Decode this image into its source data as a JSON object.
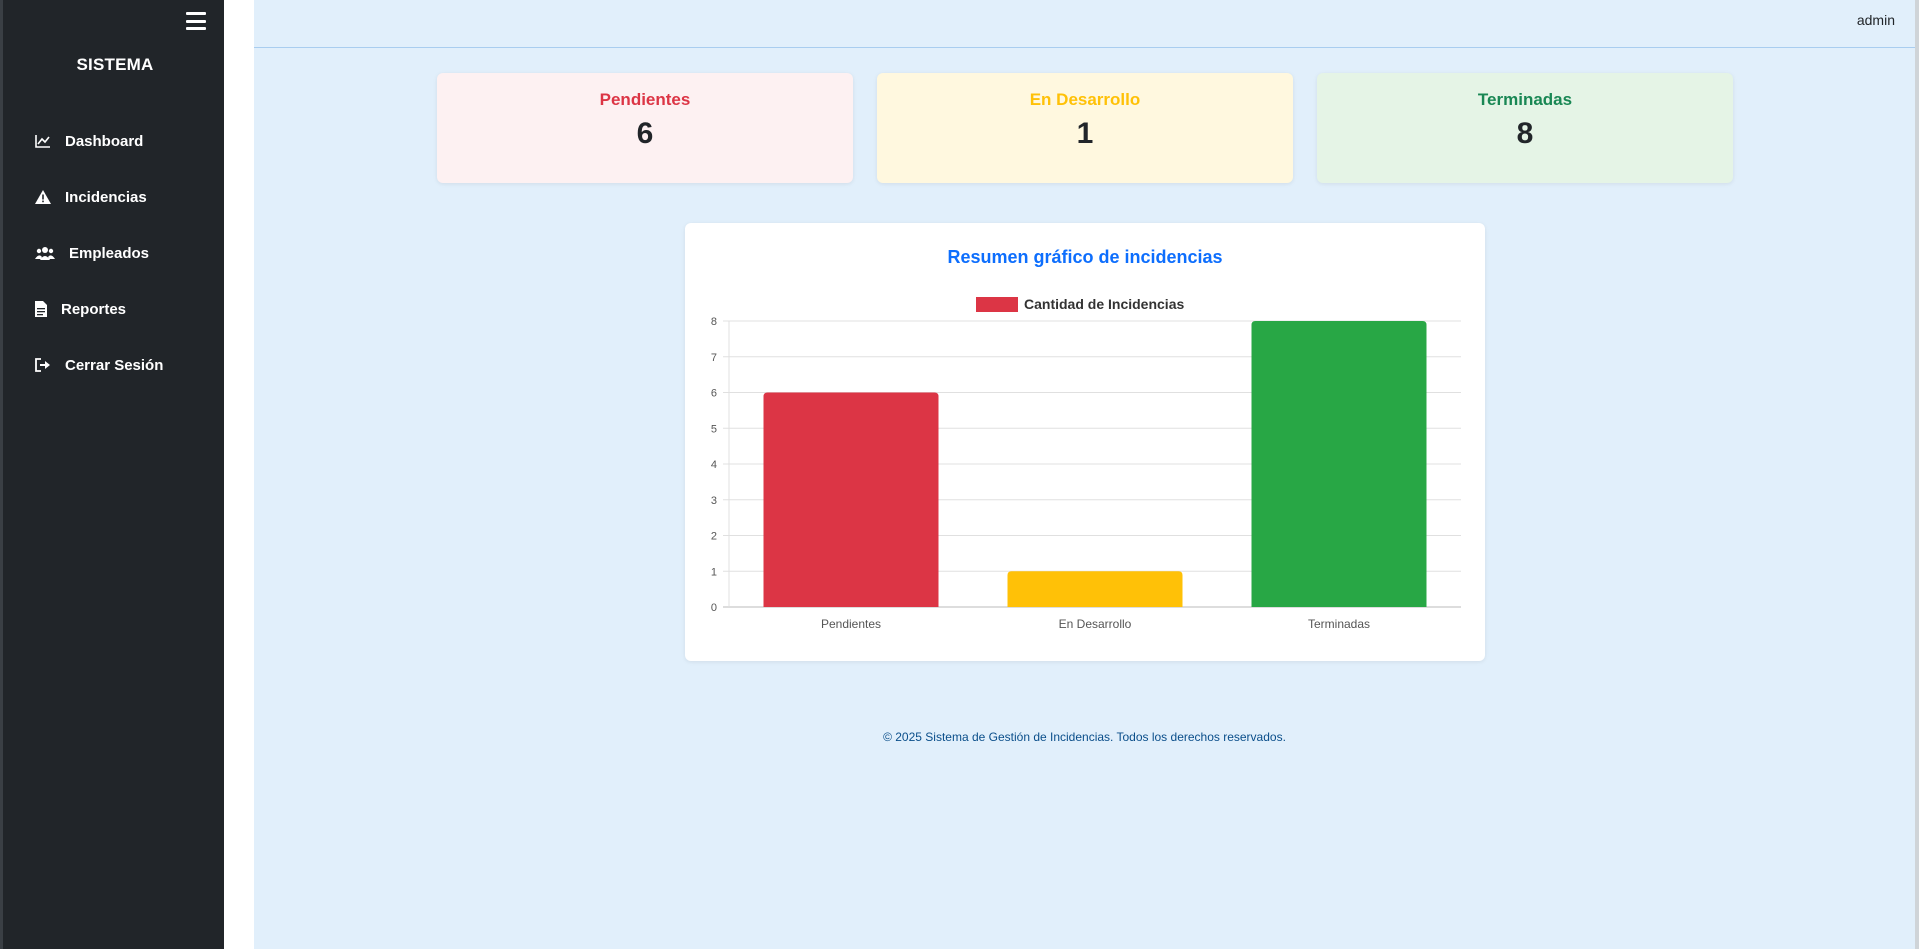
{
  "sidebar": {
    "brand": "SISTEMA",
    "items": [
      {
        "label": "Dashboard",
        "icon": "chart-line-icon"
      },
      {
        "label": "Incidencias",
        "icon": "warning-icon"
      },
      {
        "label": "Empleados",
        "icon": "users-icon"
      },
      {
        "label": "Reportes",
        "icon": "file-icon"
      },
      {
        "label": "Cerrar Sesión",
        "icon": "logout-icon"
      }
    ]
  },
  "header": {
    "user": "admin"
  },
  "cards": [
    {
      "title": "Pendientes",
      "value": "6",
      "color": "#dc3545",
      "bg": "#fdf1f2"
    },
    {
      "title": "En Desarrollo",
      "value": "1",
      "color": "#ffc107",
      "bg": "#fff8df"
    },
    {
      "title": "Terminadas",
      "value": "8",
      "color": "#198754",
      "bg": "#e5f4e6"
    }
  ],
  "chart_title": "Resumen gráfico de incidencias",
  "chart_data": {
    "type": "bar",
    "categories": [
      "Pendientes",
      "En Desarrollo",
      "Terminadas"
    ],
    "series": [
      {
        "name": "Cantidad de Incidencias",
        "values": [
          6,
          1,
          8
        ]
      }
    ],
    "colors": [
      "#dc3545",
      "#ffc107",
      "#28a745"
    ],
    "ylim": [
      0,
      8
    ],
    "yticks": [
      0,
      1,
      2,
      3,
      4,
      5,
      6,
      7,
      8
    ],
    "grid": true,
    "legend": "top-center"
  },
  "footer": "© 2025 Sistema de Gestión de Incidencias. Todos los derechos reservados."
}
